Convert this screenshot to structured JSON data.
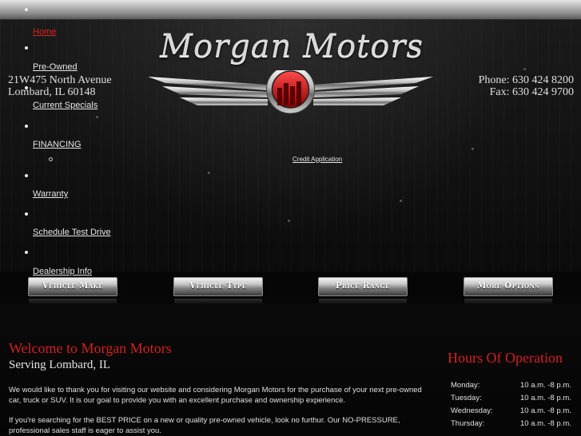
{
  "nav": {
    "items": [
      {
        "label": "Home",
        "active": true
      },
      {
        "label": "Pre-Owned"
      },
      {
        "label": "Current Specials"
      },
      {
        "label": "FINANCING"
      },
      {
        "label": "Warranty"
      },
      {
        "label": "Schedule Test Drive"
      },
      {
        "label": "Dealership Info"
      }
    ],
    "sub_items": [
      {
        "label": "Credit Application"
      }
    ]
  },
  "brand": {
    "name": "Morgan Motors"
  },
  "address": {
    "line1": "21W475 North Avenue",
    "line2": "Lombard, IL 60148"
  },
  "contact": {
    "phone": "Phone: 630 424 8200",
    "fax": "Fax: 630 424 9700"
  },
  "filters": [
    {
      "label": "Vehicle Make"
    },
    {
      "label": "Vehicle Type"
    },
    {
      "label": "Price Range"
    },
    {
      "label": "More Options"
    }
  ],
  "welcome": {
    "title": "Welcome to Morgan Motors",
    "subtitle": "Serving Lombard, IL",
    "para1": "We would like to thank you for visiting our website and considering Morgan Motors for the purchase of your next pre-owned car, truck or SUV. It is our goal to provide you with an excellent purchase and ownership experience.",
    "para2": "If you're searching for the BEST PRICE on a new or quality pre-owned vehicle, look no furthur. Our NO-PRESSURE, professional sales staff is eager to assist you."
  },
  "hours": {
    "title": "Hours Of Operation",
    "rows": [
      {
        "day": "Monday:",
        "time": "10 a.m. -8 p.m."
      },
      {
        "day": "Tuesday:",
        "time": "10 a.m. -8 p.m."
      },
      {
        "day": "Wednesday:",
        "time": "10 a.m. -8 p.m."
      },
      {
        "day": "Thursday:",
        "time": "10 a.m. -8 p.m."
      }
    ]
  },
  "colors": {
    "accent": "#d41f1f",
    "text": "#e0e0e0",
    "background": "#060606"
  }
}
